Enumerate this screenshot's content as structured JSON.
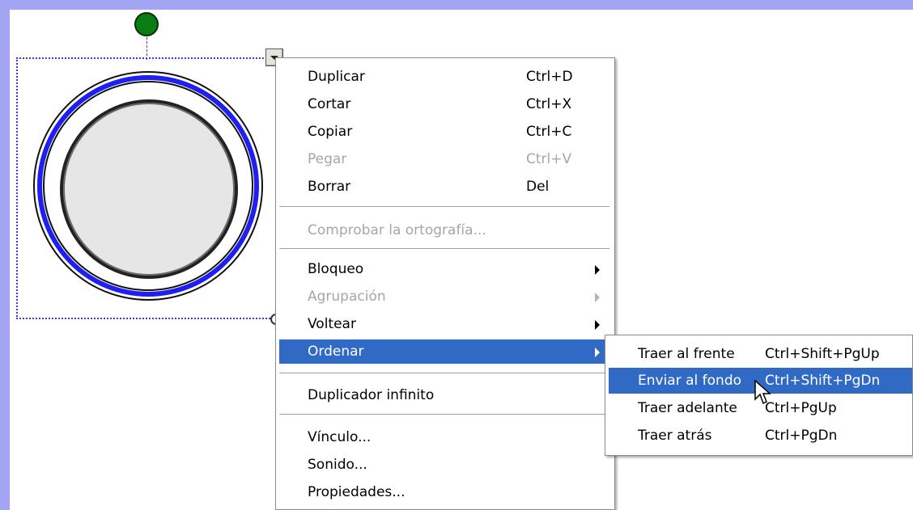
{
  "context_menu": {
    "items": [
      {
        "label": "Duplicar",
        "shortcut": "Ctrl+D"
      },
      {
        "label": "Cortar",
        "shortcut": "Ctrl+X"
      },
      {
        "label": "Copiar",
        "shortcut": "Ctrl+C"
      },
      {
        "label": "Pegar",
        "shortcut": "Ctrl+V",
        "disabled": true
      },
      {
        "label": "Borrar",
        "shortcut": "Del"
      },
      {
        "label": "Comprobar la ortografía...",
        "disabled": true
      },
      {
        "label": "Bloqueo",
        "submenu": true
      },
      {
        "label": "Agrupación",
        "submenu": true,
        "disabled": true
      },
      {
        "label": "Voltear",
        "submenu": true
      },
      {
        "label": "Ordenar",
        "submenu": true,
        "highlighted": true
      },
      {
        "label": "Duplicador infinito"
      },
      {
        "label": "Vínculo..."
      },
      {
        "label": "Sonido..."
      },
      {
        "label": "Propiedades..."
      }
    ]
  },
  "submenu_ordenar": {
    "items": [
      {
        "label": "Traer al frente",
        "shortcut": "Ctrl+Shift+PgUp"
      },
      {
        "label": "Enviar al fondo",
        "shortcut": "Ctrl+Shift+PgDn",
        "highlighted": true
      },
      {
        "label": "Traer adelante",
        "shortcut": "Ctrl+PgUp"
      },
      {
        "label": "Traer atrás",
        "shortcut": "Ctrl+PgDn"
      }
    ]
  },
  "colors": {
    "window_border": "#a4a4f4",
    "highlight": "#316ac5",
    "rotate_handle": "#0a7d12",
    "circle_ring": "#1f1ff0",
    "circle_fill": "#e6e6e6"
  },
  "icons": {
    "rotate_handle": "green-circle-icon",
    "menu_toggle": "dropdown-triangle-icon",
    "submenu_arrow": "chevron-right-icon",
    "resize_handle": "resize-circle-icon",
    "cursor": "arrow-cursor-icon"
  }
}
